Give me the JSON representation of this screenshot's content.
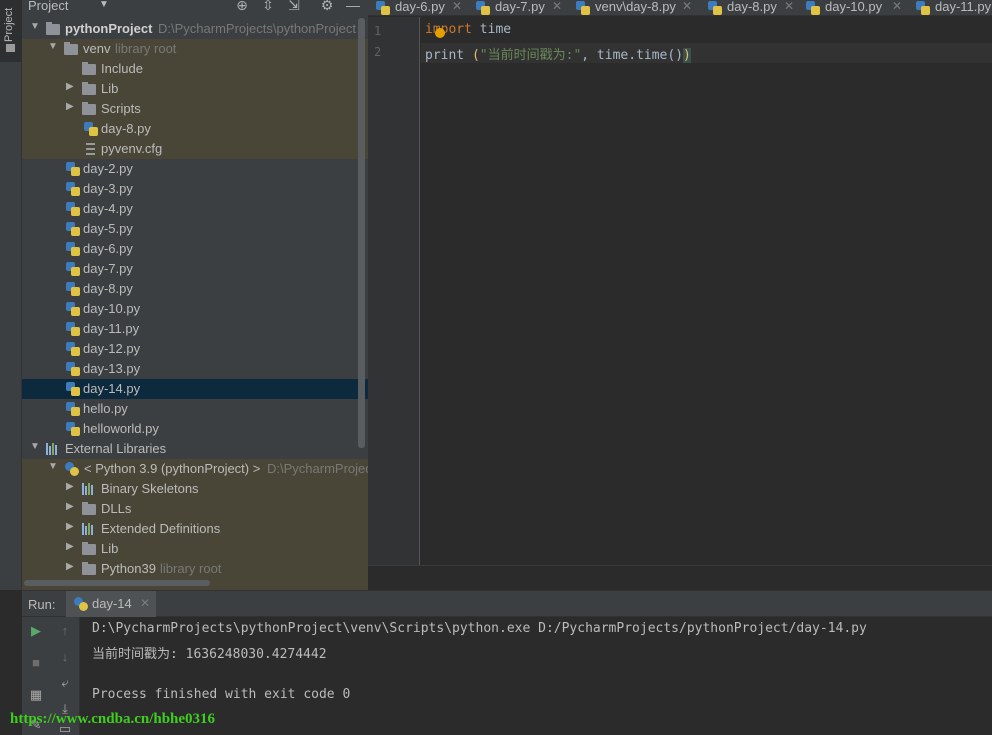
{
  "tool_strip": {
    "project_label": "Project"
  },
  "project_panel": {
    "title": "Project",
    "tree": [
      {
        "label": "pythonProject",
        "hint": "D:\\PycharmProjects\\pythonProject"
      },
      {
        "label": "venv",
        "hint": "library root"
      },
      {
        "label": "Include"
      },
      {
        "label": "Lib"
      },
      {
        "label": "Scripts"
      },
      {
        "label": "day-8.py"
      },
      {
        "label": "pyvenv.cfg"
      },
      {
        "label": "day-2.py"
      },
      {
        "label": "day-3.py"
      },
      {
        "label": "day-4.py"
      },
      {
        "label": "day-5.py"
      },
      {
        "label": "day-6.py"
      },
      {
        "label": "day-7.py"
      },
      {
        "label": "day-8.py"
      },
      {
        "label": "day-10.py"
      },
      {
        "label": "day-11.py"
      },
      {
        "label": "day-12.py"
      },
      {
        "label": "day-13.py"
      },
      {
        "label": "day-14.py"
      },
      {
        "label": "hello.py"
      },
      {
        "label": "helloworld.py"
      },
      {
        "label": "External Libraries"
      },
      {
        "label": "< Python 3.9 (pythonProject) >",
        "hint": "D:\\PycharmProjec"
      },
      {
        "label": "Binary Skeletons"
      },
      {
        "label": "DLLs"
      },
      {
        "label": "Extended Definitions"
      },
      {
        "label": "Lib"
      },
      {
        "label": "Python39",
        "hint": "library root"
      }
    ]
  },
  "tabs": [
    {
      "label": "day-6.py"
    },
    {
      "label": "day-7.py"
    },
    {
      "label": "venv\\day-8.py"
    },
    {
      "label": "day-8.py"
    },
    {
      "label": "day-10.py"
    },
    {
      "label": "day-11.py"
    }
  ],
  "editor": {
    "line_numbers": [
      "1",
      "2"
    ],
    "line1": {
      "kw": "import",
      "rest": " time"
    },
    "line2": {
      "fn": "print ",
      "paren_open": "(",
      "str": "\"当前时间戳为:\"",
      "rest": ", time.time()",
      "paren_close": ")"
    }
  },
  "run": {
    "label": "Run:",
    "tab_label": "day-14",
    "console": [
      "D:\\PycharmProjects\\pythonProject\\venv\\Scripts\\python.exe D:/PycharmProjects/pythonProject/day-14.py",
      "当前时间戳为: 1636248030.4274442",
      "",
      "Process finished with exit code 0"
    ]
  },
  "watermark": "https://www.cndba.cn/hbhe0316",
  "colors": {
    "keyword": "#cc7832",
    "string": "#6a8759",
    "selection": "#0d293e",
    "watermark": "#3ecf1e"
  }
}
